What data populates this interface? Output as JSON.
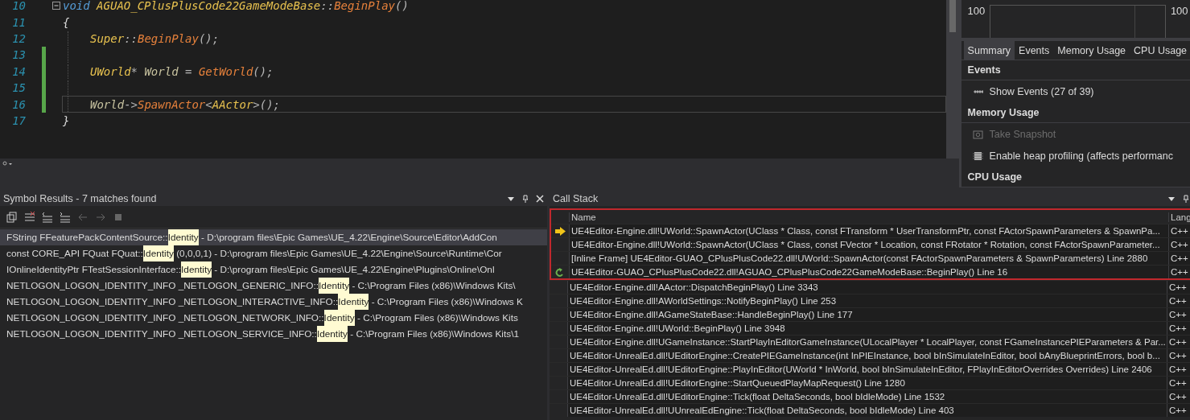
{
  "editor": {
    "lines": [
      {
        "number": "10",
        "fold": true,
        "indented": false,
        "changed": false,
        "current": false,
        "tokens": [
          {
            "kind": "keyword",
            "text": "void"
          },
          {
            "kind": "class",
            "text": "AGUAO_CPlusPlusCode22GameModeBase"
          },
          {
            "kind": "punct",
            "text": "::"
          },
          {
            "kind": "function",
            "text": "BeginPlay"
          },
          {
            "kind": "punct",
            "text": "()"
          }
        ]
      },
      {
        "number": "11",
        "fold": false,
        "indented": false,
        "changed": false,
        "current": false,
        "tokens": [
          {
            "kind": "plain",
            "text": "{"
          }
        ]
      },
      {
        "number": "12",
        "fold": false,
        "indented": true,
        "changed": false,
        "current": false,
        "tokens": [
          {
            "kind": "class",
            "text": "Super"
          },
          {
            "kind": "punct",
            "text": "::"
          },
          {
            "kind": "function",
            "text": "BeginPlay"
          },
          {
            "kind": "punct",
            "text": "();"
          }
        ]
      },
      {
        "number": "13",
        "fold": false,
        "indented": true,
        "changed": true,
        "current": false
      },
      {
        "number": "14",
        "fold": false,
        "indented": true,
        "changed": true,
        "current": false,
        "tokens": [
          {
            "kind": "class",
            "text": "UWorld"
          },
          {
            "kind": "punct",
            "text": "* "
          },
          {
            "kind": "variable",
            "text": "World"
          },
          {
            "kind": "punct",
            "text": " = "
          },
          {
            "kind": "function",
            "text": "GetWorld"
          },
          {
            "kind": "punct",
            "text": "();"
          }
        ]
      },
      {
        "number": "15",
        "fold": false,
        "indented": true,
        "changed": true,
        "current": false
      },
      {
        "number": "16",
        "fold": false,
        "indented": true,
        "changed": true,
        "current": true,
        "tokens": [
          {
            "kind": "variable",
            "text": "World"
          },
          {
            "kind": "punct",
            "text": "->"
          },
          {
            "kind": "function",
            "text": "SpawnActor"
          },
          {
            "kind": "punct",
            "text": "<"
          },
          {
            "kind": "class",
            "text": "AActor"
          },
          {
            "kind": "punct",
            "text": ">();"
          }
        ]
      },
      {
        "number": "17",
        "fold": false,
        "indented": false,
        "changed": false,
        "current": false,
        "tokens": [
          {
            "kind": "plain",
            "text": "}"
          }
        ]
      }
    ]
  },
  "diagnostics": {
    "graph": {
      "left_label": "100",
      "right_label": "100"
    },
    "tabs": [
      {
        "label": "Summary",
        "selected": true
      },
      {
        "label": "Events",
        "selected": false
      },
      {
        "label": "Memory Usage",
        "selected": false
      },
      {
        "label": "CPU Usage",
        "selected": false
      }
    ],
    "sections": [
      {
        "kind": "header",
        "text": "Events"
      },
      {
        "kind": "action",
        "text": "Show Events (27 of 39)",
        "disabled": false
      },
      {
        "kind": "header",
        "text": "Memory Usage"
      },
      {
        "kind": "action",
        "text": "Take Snapshot",
        "disabled": true
      },
      {
        "kind": "action",
        "text": "Enable heap profiling (affects performanc",
        "disabled": false
      },
      {
        "kind": "header",
        "text": "CPU Usage"
      }
    ]
  },
  "symbol_results": {
    "title": "Symbol Results - 7 matches found",
    "rows": [
      {
        "before": "FString FFeaturePackContentSource::",
        "match": "Identity",
        "after": " - D:\\program files\\Epic Games\\UE_4.22\\Engine\\Source\\Editor\\AddCon",
        "selected": true
      },
      {
        "before": "const CORE_API FQuat FQuat::",
        "match": "Identity",
        "after": " (0,0,0,1) - D:\\program files\\Epic Games\\UE_4.22\\Engine\\Source\\Runtime\\Cor",
        "selected": false
      },
      {
        "before": "IOnlineIdentityPtr FTestSessionInterface::",
        "match": "Identity",
        "after": " - D:\\program files\\Epic Games\\UE_4.22\\Engine\\Plugins\\Online\\Onl",
        "selected": false
      },
      {
        "before": "NETLOGON_LOGON_IDENTITY_INFO _NETLOGON_GENERIC_INFO::",
        "match": "Identity",
        "after": " - C:\\Program Files (x86)\\Windows Kits\\",
        "selected": false
      },
      {
        "before": "NETLOGON_LOGON_IDENTITY_INFO _NETLOGON_INTERACTIVE_INFO::",
        "match": "Identity",
        "after": " - C:\\Program Files (x86)\\Windows K",
        "selected": false
      },
      {
        "before": "NETLOGON_LOGON_IDENTITY_INFO _NETLOGON_NETWORK_INFO::",
        "match": "Identity",
        "after": " - C:\\Program Files (x86)\\Windows Kits",
        "selected": false
      },
      {
        "before": "NETLOGON_LOGON_IDENTITY_INFO _NETLOGON_SERVICE_INFO::",
        "match": "Identity",
        "after": " - C:\\Program Files (x86)\\Windows Kits\\1",
        "selected": false
      }
    ]
  },
  "call_stack": {
    "title": "Call Stack",
    "columns": [
      "Name",
      "Lang"
    ],
    "header_boxed": true,
    "rows": [
      {
        "current": true,
        "selected": false,
        "boxed": true,
        "name": "UE4Editor-Engine.dll!UWorld::SpawnActor(UClass * Class, const FTransform * UserTransformPtr, const FActorSpawnParameters & SpawnPa...",
        "lang": "C++"
      },
      {
        "current": false,
        "selected": false,
        "boxed": true,
        "name": "UE4Editor-Engine.dll!UWorld::SpawnActor(UClass * Class, const FVector * Location, const FRotator * Rotation, const FActorSpawnParameter...",
        "lang": "C++"
      },
      {
        "current": false,
        "selected": false,
        "boxed": true,
        "name": "[Inline Frame] UE4Editor-GUAO_CPlusPlusCode22.dll!UWorld::SpawnActor(const FActorSpawnParameters & SpawnParameters) Line 2880",
        "lang": "C++"
      },
      {
        "current": false,
        "selected": true,
        "boxed": true,
        "name": "UE4Editor-GUAO_CPlusPlusCode22.dll!AGUAO_CPlusPlusCode22GameModeBase::BeginPlay() Line 16",
        "lang": "C++"
      },
      {
        "current": false,
        "selected": false,
        "boxed": false,
        "name": "UE4Editor-Engine.dll!AActor::DispatchBeginPlay() Line 3343",
        "lang": "C++"
      },
      {
        "current": false,
        "selected": false,
        "boxed": false,
        "name": "UE4Editor-Engine.dll!AWorldSettings::NotifyBeginPlay() Line 253",
        "lang": "C++"
      },
      {
        "current": false,
        "selected": false,
        "boxed": false,
        "name": "UE4Editor-Engine.dll!AGameStateBase::HandleBeginPlay() Line 177",
        "lang": "C++"
      },
      {
        "current": false,
        "selected": false,
        "boxed": false,
        "name": "UE4Editor-Engine.dll!UWorld::BeginPlay() Line 3948",
        "lang": "C++"
      },
      {
        "current": false,
        "selected": false,
        "boxed": false,
        "name": "UE4Editor-Engine.dll!UGameInstance::StartPlayInEditorGameInstance(ULocalPlayer * LocalPlayer, const FGameInstancePIEParameters & Par...",
        "lang": "C++"
      },
      {
        "current": false,
        "selected": false,
        "boxed": false,
        "name": "UE4Editor-UnrealEd.dll!UEditorEngine::CreatePIEGameInstance(int InPIEInstance, bool bInSimulateInEditor, bool bAnyBlueprintErrors, bool b...",
        "lang": "C++"
      },
      {
        "current": false,
        "selected": false,
        "boxed": false,
        "name": "UE4Editor-UnrealEd.dll!UEditorEngine::PlayInEditor(UWorld * InWorld, bool bInSimulateInEditor, FPlayInEditorOverrides Overrides) Line 2406",
        "lang": "C++"
      },
      {
        "current": false,
        "selected": false,
        "boxed": false,
        "name": "UE4Editor-UnrealEd.dll!UEditorEngine::StartQueuedPlayMapRequest() Line 1280",
        "lang": "C++"
      },
      {
        "current": false,
        "selected": false,
        "boxed": false,
        "name": "UE4Editor-UnrealEd.dll!UEditorEngine::Tick(float DeltaSeconds, bool bIdleMode) Line 1532",
        "lang": "C++"
      },
      {
        "current": false,
        "selected": false,
        "boxed": false,
        "name": "UE4Editor-UnrealEd.dll!UUnrealEdEngine::Tick(float DeltaSeconds, bool bIdleMode) Line 403",
        "lang": "C++"
      }
    ]
  }
}
